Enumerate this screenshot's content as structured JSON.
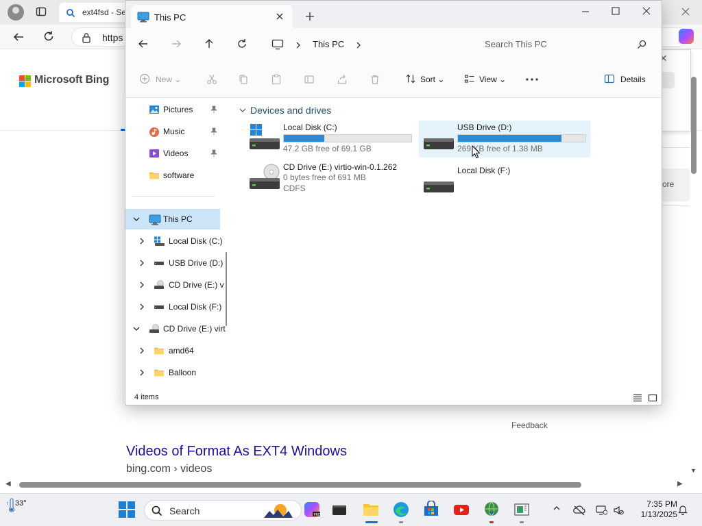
{
  "browser": {
    "tab_title": "ext4fsd - Se",
    "url": "https",
    "bing_brand": "Microsoft Bing",
    "more_label": "ore",
    "feedback": "Feedback",
    "result": {
      "title": "Videos of Format As EXT4 Windows",
      "url": "bing.com › videos"
    }
  },
  "explorer": {
    "tab_title": "This PC",
    "breadcrumb": [
      "This PC"
    ],
    "search_placeholder": "Search This PC",
    "commands": {
      "new": "New",
      "sort": "Sort",
      "view": "View",
      "details": "Details"
    },
    "sidebar": {
      "quick_access": [
        {
          "label": "Pictures",
          "icon": "pictures-icon",
          "pinned": true
        },
        {
          "label": "Music",
          "icon": "music-icon",
          "pinned": true
        },
        {
          "label": "Videos",
          "icon": "videos-icon",
          "pinned": true
        },
        {
          "label": "software",
          "icon": "folder-icon",
          "pinned": false
        }
      ],
      "this_pc": {
        "label": "This PC",
        "icon": "this-pc-icon"
      },
      "drives": [
        {
          "label": "Local Disk (C:)",
          "icon": "windows-drive-icon"
        },
        {
          "label": "USB Drive (D:)",
          "icon": "usb-drive-icon"
        },
        {
          "label": "CD Drive (E:) v",
          "icon": "cd-drive-icon"
        },
        {
          "label": "Local Disk (F:)",
          "icon": "drive-icon"
        }
      ],
      "cd_expanded": {
        "label": "CD Drive (E:) virt",
        "icon": "cd-drive-icon"
      },
      "cd_folders": [
        {
          "label": "amd64",
          "icon": "folder-icon"
        },
        {
          "label": "Balloon",
          "icon": "folder-icon"
        }
      ]
    },
    "group_header": "Devices and drives",
    "drives": [
      {
        "name": "Local Disk (C:)",
        "free": "47.2 GB free of 69.1 GB",
        "used_fraction": 0.317,
        "type": "windows"
      },
      {
        "name": "USB Drive (D:)",
        "free": "269 KB free of 1.38 MB",
        "used_fraction": 0.81,
        "type": "usb"
      },
      {
        "name": "CD Drive (E:) virtio-win-0.1.262",
        "free": "0 bytes free of 691 MB",
        "fs": "CDFS",
        "type": "cd"
      },
      {
        "name": "Local Disk (F:)",
        "type": "disk"
      }
    ],
    "status": "4 items"
  },
  "taskbar": {
    "weather_temp": "33°",
    "search_label": "Search",
    "clock_time": "7:35 PM",
    "clock_date": "1/13/2025"
  },
  "colors": {
    "accent": "#0078d4",
    "bar_fill": "#2a8ad4",
    "selection": "#cce4f7",
    "link": "#1a0dab"
  }
}
